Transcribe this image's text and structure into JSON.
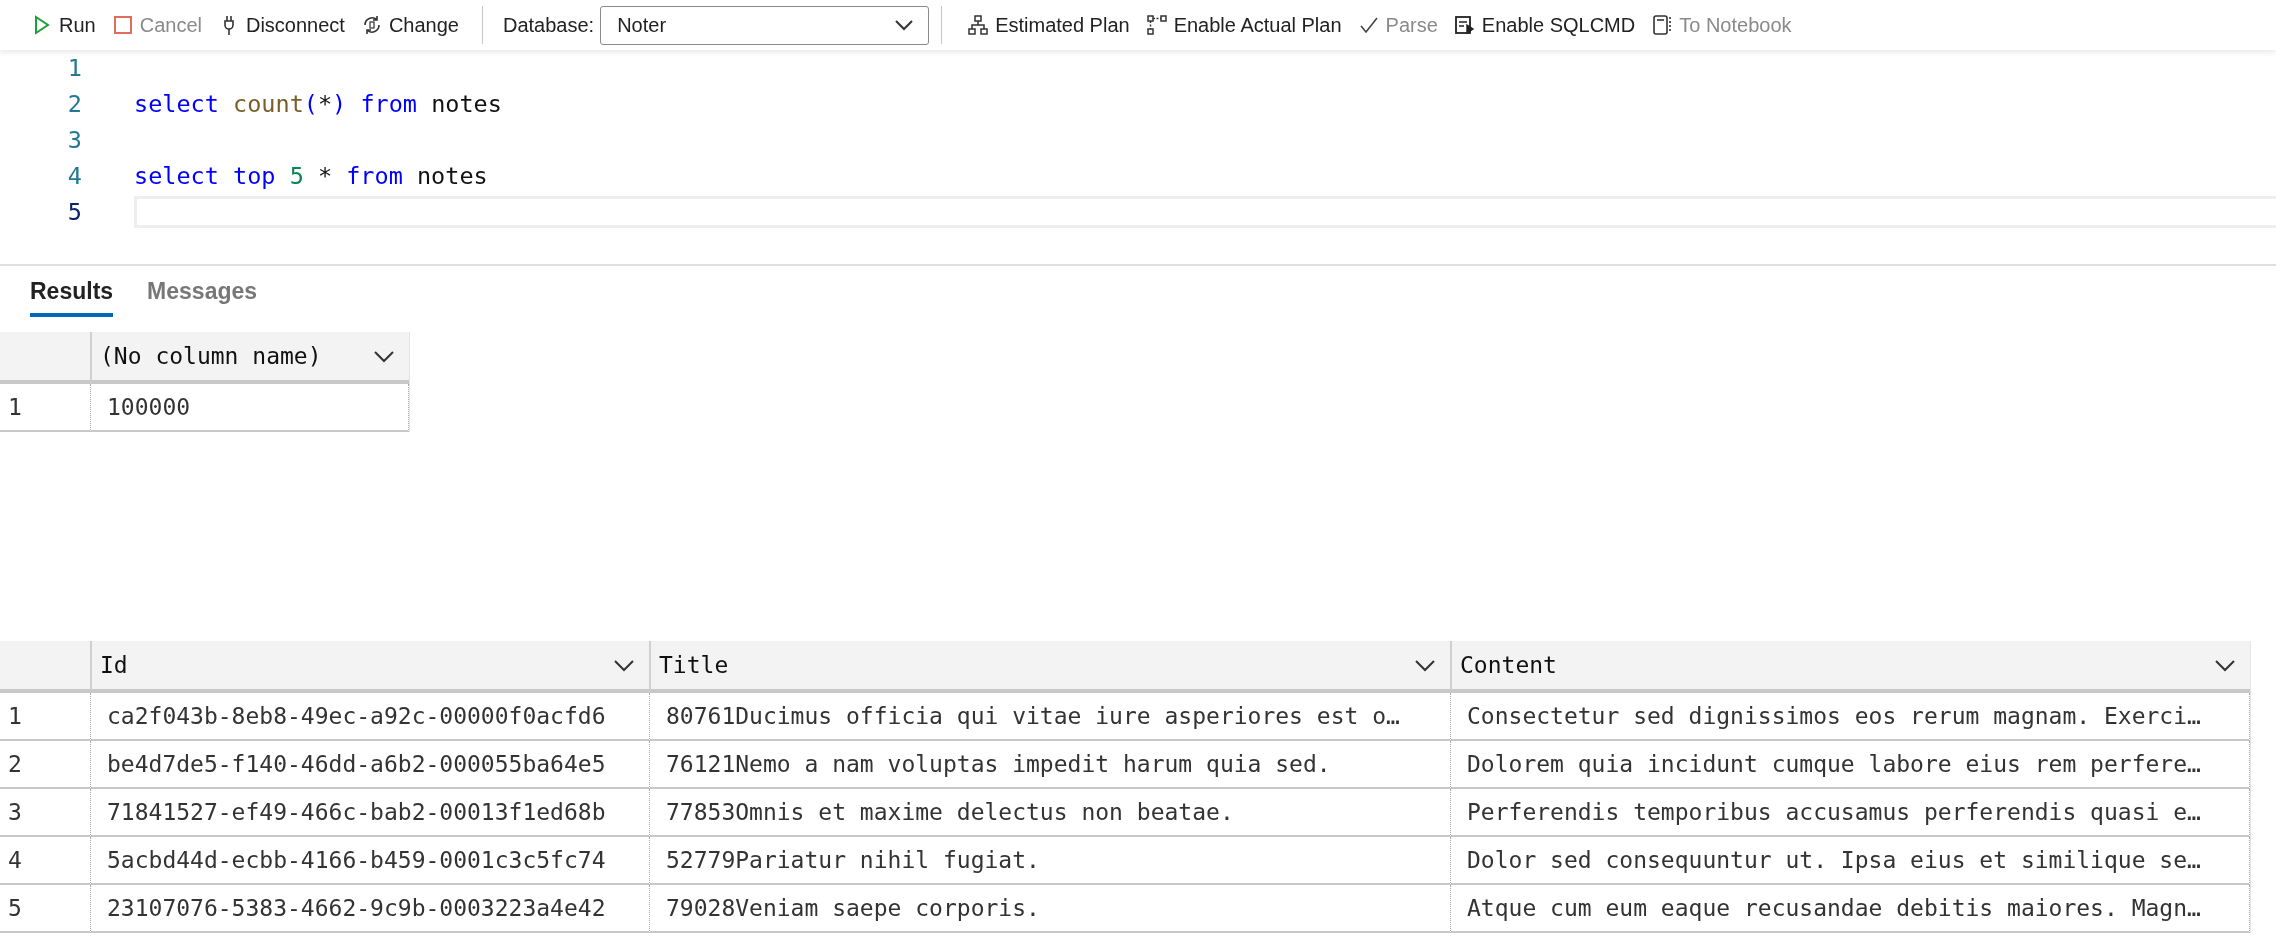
{
  "toolbar": {
    "items": [
      {
        "kind": "run",
        "label": "Run",
        "disabled": false
      },
      {
        "kind": "cancel",
        "label": "Cancel",
        "disabled": true
      },
      {
        "kind": "disconnect",
        "label": "Disconnect",
        "disabled": false
      },
      {
        "kind": "change",
        "label": "Change",
        "disabled": false
      }
    ],
    "database": {
      "label": "Database:",
      "value": "Noter"
    },
    "actions": [
      {
        "kind": "estimate",
        "label": "Estimated Plan",
        "disabled": false
      },
      {
        "kind": "actual",
        "label": "Enable Actual Plan",
        "disabled": false
      },
      {
        "kind": "parse",
        "label": "Parse",
        "disabled": true
      },
      {
        "kind": "sqlcmd",
        "label": "Enable SQLCMD",
        "disabled": false
      },
      {
        "kind": "notebook",
        "label": "To Notebook",
        "disabled": true
      }
    ]
  },
  "editor": {
    "lines": [
      {
        "number": "1",
        "current": false
      },
      {
        "number": "2",
        "current": false,
        "tokens": [
          {
            "kind": "keyword",
            "text": "select"
          },
          {
            "kind": "function",
            "text": " count"
          },
          {
            "kind": "keyword",
            "text": "("
          },
          {
            "kind": "plain",
            "text": "*"
          },
          {
            "kind": "keyword",
            "text": ")"
          },
          {
            "kind": "keyword",
            "text": " from"
          },
          {
            "kind": "plain",
            "text": " notes"
          }
        ]
      },
      {
        "number": "3",
        "current": false
      },
      {
        "number": "4",
        "current": false,
        "tokens": [
          {
            "kind": "keyword",
            "text": "select"
          },
          {
            "kind": "keyword",
            "text": " top"
          },
          {
            "kind": "number",
            "text": " 5"
          },
          {
            "kind": "plain",
            "text": " *"
          },
          {
            "kind": "keyword",
            "text": " from"
          },
          {
            "kind": "plain",
            "text": " notes"
          }
        ]
      },
      {
        "number": "5",
        "current": true
      }
    ]
  },
  "results_tabs": [
    {
      "label": "Results",
      "selected": true
    },
    {
      "label": "Messages",
      "selected": false
    }
  ],
  "grids": [
    {
      "columns": [
        "(No column name)"
      ],
      "rows": [
        {
          "number": "1",
          "cells": [
            "100000"
          ]
        }
      ]
    },
    {
      "columns": [
        "Id",
        "Title",
        "Content"
      ],
      "rows": [
        {
          "number": "1",
          "cells": [
            "ca2f043b-8eb8-49ec-a92c-00000f0acfd6",
            "80761Ducimus officia qui vitae iure asperiores est o…",
            "Consectetur sed dignissimos eos rerum magnam. Exerci…"
          ]
        },
        {
          "number": "2",
          "cells": [
            "be4d7de5-f140-46dd-a6b2-000055ba64e5",
            "76121Nemo a nam voluptas impedit harum quia sed.",
            "Dolorem quia incidunt cumque labore eius rem perfere…"
          ]
        },
        {
          "number": "3",
          "cells": [
            "71841527-ef49-466c-bab2-00013f1ed68b",
            "77853Omnis et maxime delectus non beatae.",
            "Perferendis temporibus accusamus perferendis quasi e…"
          ]
        },
        {
          "number": "4",
          "cells": [
            "5acbd44d-ecbb-4166-b459-0001c3c5fc74",
            "52779Pariatur nihil fugiat.",
            "Dolor sed consequuntur ut. Ipsa eius et similique se…"
          ]
        },
        {
          "number": "5",
          "cells": [
            "23107076-5383-4662-9c9b-0003223a4e42",
            "79028Veniam saepe corporis.",
            "Atque cum eum eaque recusandae debitis maiores. Magn…"
          ]
        }
      ]
    }
  ]
}
